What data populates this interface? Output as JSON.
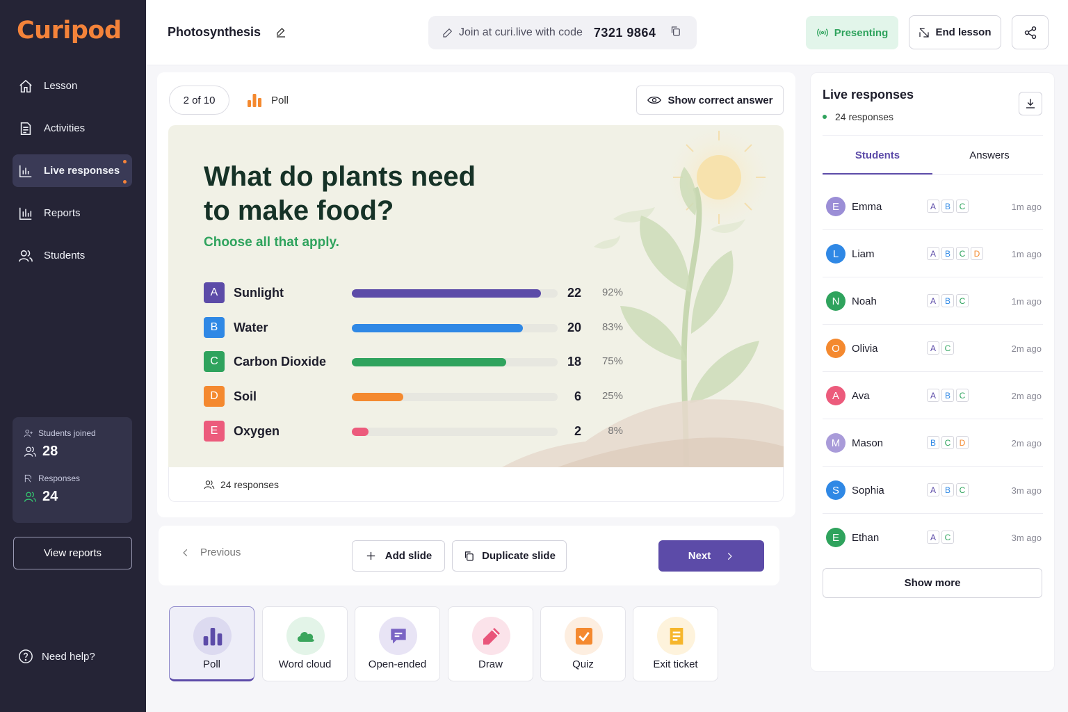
{
  "app": {
    "logo": "Curipod"
  },
  "sidebar": {
    "items": [
      {
        "label": "Lesson",
        "icon": "home-icon"
      },
      {
        "label": "Activities",
        "icon": "activities-icon"
      },
      {
        "label": "Live responses",
        "icon": "bar-chart-icon"
      },
      {
        "label": "Reports",
        "icon": "reports-icon"
      },
      {
        "label": "Students",
        "icon": "students-icon"
      }
    ],
    "stats": {
      "joined_label": "Students joined",
      "joined_value": "28",
      "responses_label": "Responses",
      "responses_value": "24"
    },
    "view_reports": "View reports",
    "help": "Need help?"
  },
  "header": {
    "title": "Photosynthesis",
    "join_text": "Join at curi.live with code",
    "join_code": "7321 9864",
    "presenting": "Presenting",
    "end_lesson": "End lesson"
  },
  "slide": {
    "count": "2 of 10",
    "type": "Poll",
    "show_correct": "Show correct answer",
    "question": "What do plants need to make food?",
    "instruction": "Choose all that apply.",
    "options": [
      {
        "letter": "A",
        "text": "Sunlight",
        "count": "22",
        "pct": "92%",
        "value": 0.92,
        "color": "#5c4ba8"
      },
      {
        "letter": "B",
        "text": "Water",
        "count": "20",
        "pct": "83%",
        "value": 0.83,
        "color": "#2f88e5"
      },
      {
        "letter": "C",
        "text": "Carbon Dioxide",
        "count": "18",
        "pct": "75%",
        "value": 0.75,
        "color": "#2fa35d"
      },
      {
        "letter": "D",
        "text": "Soil",
        "count": "6",
        "pct": "25%",
        "value": 0.25,
        "color": "#f4892f"
      },
      {
        "letter": "E",
        "text": "Oxygen",
        "count": "2",
        "pct": "8%",
        "value": 0.08,
        "color": "#ec5b7c"
      }
    ],
    "footer": "24 responses"
  },
  "controls": {
    "previous": "Previous",
    "add_slide": "Add slide",
    "duplicate_slide": "Duplicate slide",
    "next": "Next"
  },
  "activity_types": [
    {
      "label": "Poll",
      "icon": "poll-icon",
      "selected": true
    },
    {
      "label": "Word cloud",
      "icon": "cloud-icon"
    },
    {
      "label": "Open-ended",
      "icon": "message-icon"
    },
    {
      "label": "Draw",
      "icon": "pencil-icon"
    },
    {
      "label": "Quiz",
      "icon": "quiz-check-icon"
    },
    {
      "label": "Exit ticket",
      "icon": "ticket-icon"
    }
  ],
  "live": {
    "title": "Live responses",
    "subtitle": "24 responses",
    "tabs": [
      "Students",
      "Answers"
    ],
    "students": [
      {
        "initial": "E",
        "name": "Emma",
        "answers": [
          "A",
          "B",
          "C"
        ],
        "time": "1m ago",
        "color": "#9b8ed6"
      },
      {
        "initial": "L",
        "name": "Liam",
        "answers": [
          "A",
          "B",
          "C",
          "D"
        ],
        "time": "1m ago",
        "color": "#2f88e5"
      },
      {
        "initial": "N",
        "name": "Noah",
        "answers": [
          "A",
          "B",
          "C"
        ],
        "time": "1m ago",
        "color": "#2fa35d"
      },
      {
        "initial": "O",
        "name": "Olivia",
        "answers": [
          "A",
          "C"
        ],
        "time": "2m ago",
        "color": "#f4892f"
      },
      {
        "initial": "A",
        "name": "Ava",
        "answers": [
          "A",
          "B",
          "C"
        ],
        "time": "2m ago",
        "color": "#ec5b7c"
      },
      {
        "initial": "M",
        "name": "Mason",
        "answers": [
          "B",
          "C",
          "D"
        ],
        "time": "2m ago",
        "color": "#a99bd9"
      },
      {
        "initial": "S",
        "name": "Sophia",
        "answers": [
          "A",
          "B",
          "C"
        ],
        "time": "3m ago",
        "color": "#2f88e5"
      },
      {
        "initial": "E",
        "name": "Ethan",
        "answers": [
          "A",
          "C"
        ],
        "time": "3m ago",
        "color": "#2fa35d"
      }
    ],
    "show_more": "Show more"
  },
  "letter_colors": {
    "A": "#5c4ba8",
    "B": "#2f88e5",
    "C": "#2fa35d",
    "D": "#f4892f",
    "E": "#ec5b7c"
  }
}
